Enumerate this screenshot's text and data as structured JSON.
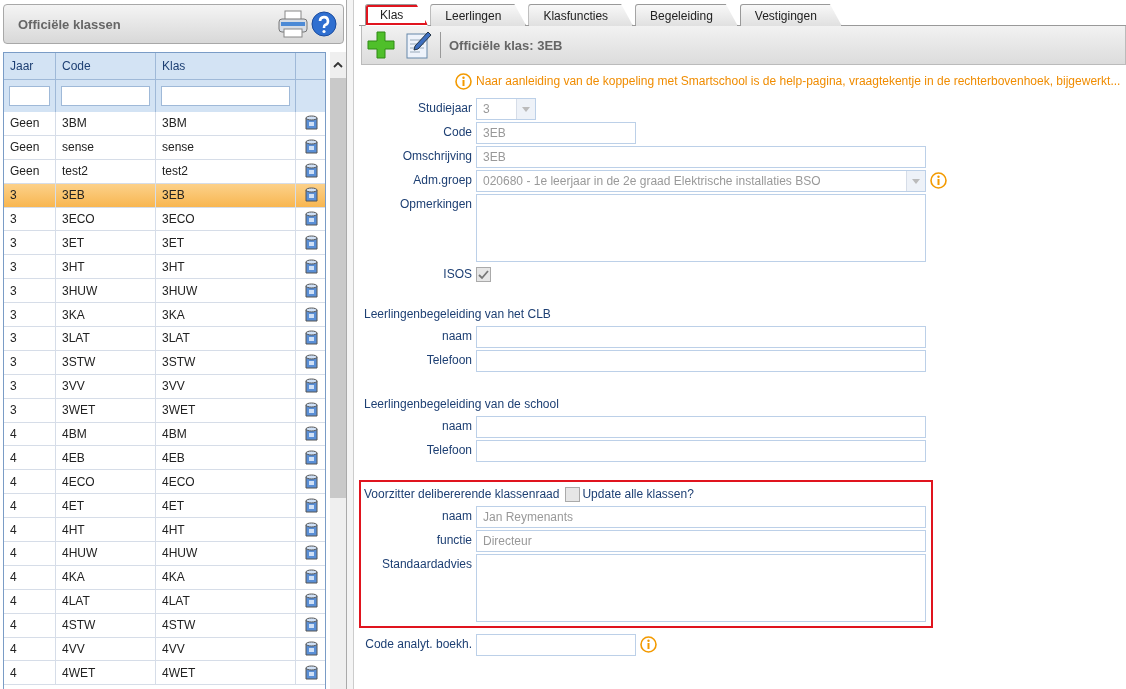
{
  "left_panel": {
    "title": "Officiële klassen",
    "table": {
      "columns": [
        "Jaar",
        "Code",
        "Klas"
      ],
      "rows": [
        {
          "jaar": "Geen",
          "code": "3BM",
          "klas": "3BM",
          "selected": false
        },
        {
          "jaar": "Geen",
          "code": "sense",
          "klas": "sense",
          "selected": false
        },
        {
          "jaar": "Geen",
          "code": "test2",
          "klas": "test2",
          "selected": false
        },
        {
          "jaar": "3",
          "code": "3EB",
          "klas": "3EB",
          "selected": true
        },
        {
          "jaar": "3",
          "code": "3ECO",
          "klas": "3ECO",
          "selected": false
        },
        {
          "jaar": "3",
          "code": "3ET",
          "klas": "3ET",
          "selected": false
        },
        {
          "jaar": "3",
          "code": "3HT",
          "klas": "3HT",
          "selected": false
        },
        {
          "jaar": "3",
          "code": "3HUW",
          "klas": "3HUW",
          "selected": false
        },
        {
          "jaar": "3",
          "code": "3KA",
          "klas": "3KA",
          "selected": false
        },
        {
          "jaar": "3",
          "code": "3LAT",
          "klas": "3LAT",
          "selected": false
        },
        {
          "jaar": "3",
          "code": "3STW",
          "klas": "3STW",
          "selected": false
        },
        {
          "jaar": "3",
          "code": "3VV",
          "klas": "3VV",
          "selected": false
        },
        {
          "jaar": "3",
          "code": "3WET",
          "klas": "3WET",
          "selected": false
        },
        {
          "jaar": "4",
          "code": "4BM",
          "klas": "4BM",
          "selected": false
        },
        {
          "jaar": "4",
          "code": "4EB",
          "klas": "4EB",
          "selected": false
        },
        {
          "jaar": "4",
          "code": "4ECO",
          "klas": "4ECO",
          "selected": false
        },
        {
          "jaar": "4",
          "code": "4ET",
          "klas": "4ET",
          "selected": false
        },
        {
          "jaar": "4",
          "code": "4HT",
          "klas": "4HT",
          "selected": false
        },
        {
          "jaar": "4",
          "code": "4HUW",
          "klas": "4HUW",
          "selected": false
        },
        {
          "jaar": "4",
          "code": "4KA",
          "klas": "4KA",
          "selected": false
        },
        {
          "jaar": "4",
          "code": "4LAT",
          "klas": "4LAT",
          "selected": false
        },
        {
          "jaar": "4",
          "code": "4STW",
          "klas": "4STW",
          "selected": false
        },
        {
          "jaar": "4",
          "code": "4VV",
          "klas": "4VV",
          "selected": false
        },
        {
          "jaar": "4",
          "code": "4WET",
          "klas": "4WET",
          "selected": false
        }
      ]
    }
  },
  "tabs": [
    {
      "label": "Klas",
      "selected": true,
      "highlighted": true
    },
    {
      "label": "Leerlingen",
      "selected": false,
      "highlighted": false
    },
    {
      "label": "Klasfuncties",
      "selected": false,
      "highlighted": false
    },
    {
      "label": "Begeleiding",
      "selected": false,
      "highlighted": false
    },
    {
      "label": "Vestigingen",
      "selected": false,
      "highlighted": false
    }
  ],
  "toolbar": {
    "title": "Officiële klas: 3EB"
  },
  "notice": "Naar aanleiding van de koppeling met Smartschool is de help-pagina, vraagtekentje in de rechterbovenhoek, bijgewerkt...",
  "sections": [
    {
      "fields": [
        {
          "kind": "select",
          "label": "Studiejaar",
          "value": "3",
          "info": false
        },
        {
          "kind": "text",
          "label": "Code",
          "value": "3EB",
          "info": false
        },
        {
          "kind": "text",
          "label": "Omschrijving",
          "value": "3EB",
          "info": false
        },
        {
          "kind": "select",
          "label": "Adm.groep",
          "value": "020680 - 1e leerjaar in de 2e graad Elektrische installaties BSO",
          "info": true
        },
        {
          "kind": "textarea",
          "label": "Opmerkingen",
          "info": false
        },
        {
          "kind": "checkbox",
          "label": "ISOS",
          "checked": true,
          "info": false
        }
      ]
    },
    {
      "heading": "Leerlingenbegeleiding van het CLB",
      "fields": [
        {
          "kind": "text",
          "label": "naam",
          "info": false
        },
        {
          "kind": "text",
          "label": "Telefoon",
          "info": false
        }
      ]
    },
    {
      "heading": "Leerlingenbegeleiding van de school",
      "fields": [
        {
          "kind": "text",
          "label": "naam",
          "info": false
        },
        {
          "kind": "text",
          "label": "Telefoon",
          "info": false
        }
      ]
    },
    {
      "heading": "Voorzitter delibererende klassenraad",
      "highlighted": true,
      "option": {
        "label": "Update alle klassen?",
        "checked": false
      },
      "fields": [
        {
          "kind": "text",
          "label": "naam",
          "value": "Jan Reymenants",
          "info": false
        },
        {
          "kind": "text",
          "label": "functie",
          "value": "Directeur",
          "info": false
        },
        {
          "kind": "textarea",
          "label": "Standaardadvies",
          "info": false
        }
      ]
    },
    {
      "fields": [
        {
          "kind": "text",
          "label": "Code analyt. boekh.",
          "info": true
        }
      ]
    }
  ]
}
